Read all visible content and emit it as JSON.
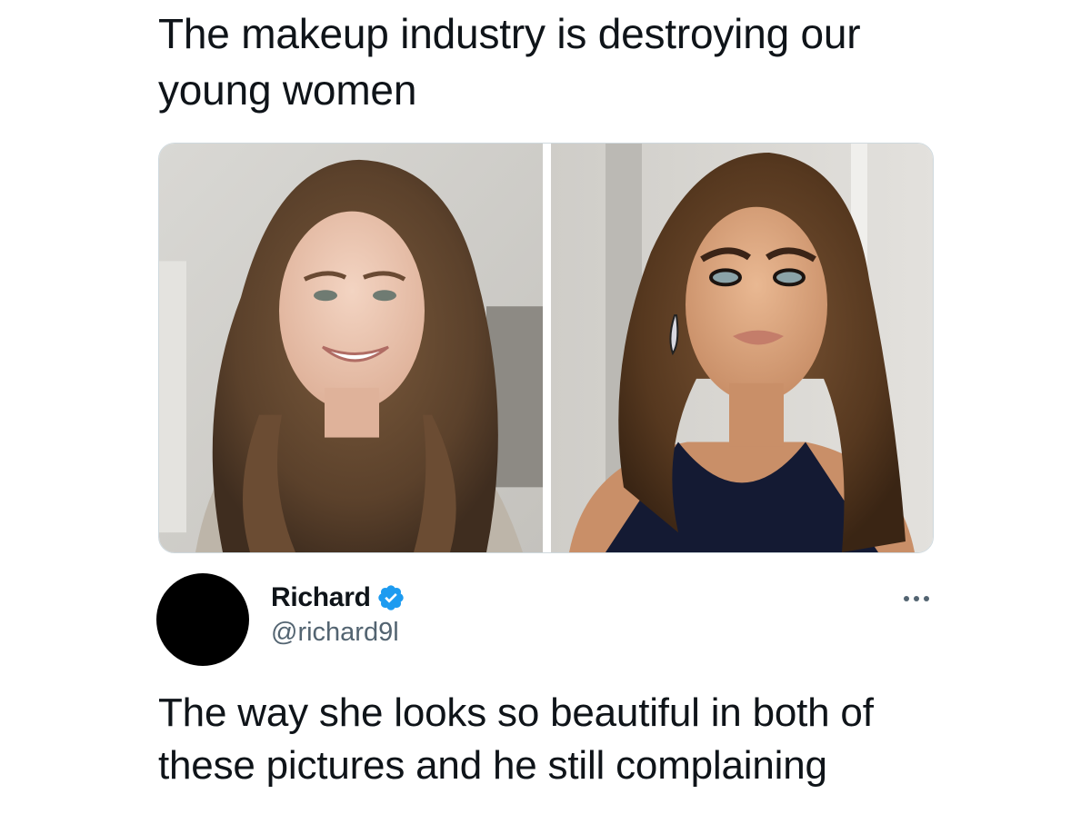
{
  "quoted_post": {
    "text": "The makeup industry is destroying our young women"
  },
  "media": {
    "images": [
      {
        "icon": "photo-woman-no-makeup"
      },
      {
        "icon": "photo-woman-full-makeup"
      }
    ]
  },
  "reply": {
    "display_name": "Richard",
    "verified_icon": "verified-badge-icon",
    "handle": "@richard9l",
    "more_icon": "more-options-icon",
    "text": "The way she looks so beautiful in both of these pictures and he still complaining"
  },
  "colors": {
    "text_primary": "#0f1419",
    "text_secondary": "#536471",
    "verified_blue": "#1d9bf0",
    "border": "#cfd9de"
  }
}
